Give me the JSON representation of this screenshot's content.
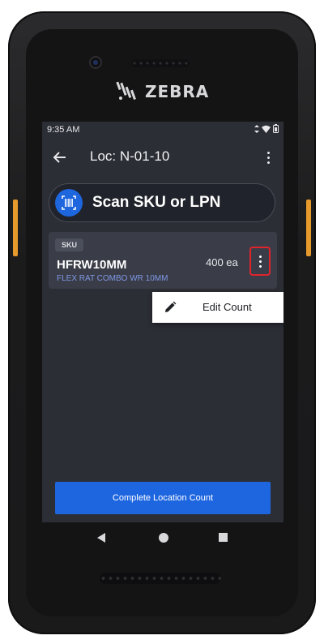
{
  "device": {
    "brand": "ZEBRA"
  },
  "status_bar": {
    "time": "9:35 AM"
  },
  "app_bar": {
    "title": "Loc: N-01-10"
  },
  "scan": {
    "label": "Scan SKU or LPN"
  },
  "item": {
    "chip": "SKU",
    "code": "HFRW10MM",
    "description": "FLEX RAT COMBO WR 10MM",
    "quantity": "400 ea"
  },
  "popup_menu": {
    "items": [
      {
        "label": "Edit Count",
        "icon": "pencil-icon"
      }
    ]
  },
  "footer": {
    "complete_label": "Complete Location Count"
  },
  "colors": {
    "accent": "#1e66e0",
    "highlight": "#e0232b",
    "screen_bg": "#2c2e36"
  }
}
